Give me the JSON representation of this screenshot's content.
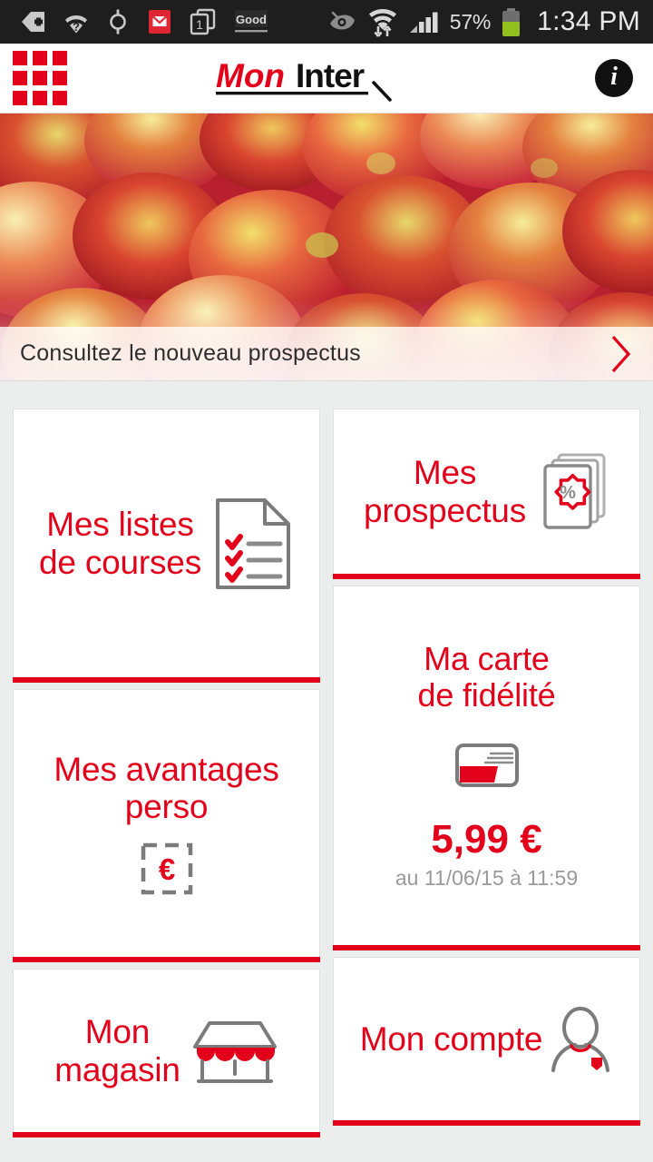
{
  "status_bar": {
    "time": "1:34 PM",
    "battery_percent": "57%",
    "battery_level": 57,
    "icons_left": [
      "plus-badge-icon",
      "wifi-question-icon",
      "gps-crosshair-icon",
      "mail-icon",
      "tasks-stack-icon",
      "good-app-icon"
    ],
    "icons_right": [
      "smart-stay-eye-icon",
      "wifi-data-icon",
      "cellular-signal-icon"
    ],
    "good_label": "Good",
    "task_count": "1"
  },
  "header": {
    "menu_icon": "grid-menu-icon",
    "logo": {
      "part_red": "Mon",
      "part_black": "Inter",
      "alt": "MonInter"
    },
    "info_icon": "info-icon",
    "info_glyph": "i"
  },
  "hero": {
    "image_alt": "red apples",
    "caption": "Consultez le nouveau prospectus",
    "chevron_icon": "chevron-right-icon"
  },
  "colors": {
    "brand_red": "#e3001b",
    "accent_gray": "#7b7b7b",
    "page_bg": "#eceded",
    "tile_bg": "#ffffff",
    "muted_text": "#9a9a9a"
  },
  "tiles": {
    "mes_listes": {
      "label": "Mes listes\nde courses",
      "line1": "Mes listes",
      "line2": "de courses",
      "icon": "document-checklist-icon"
    },
    "mes_avantages": {
      "label": "Mes avantages\nperso",
      "line1": "Mes avantages",
      "line2": "perso",
      "icon": "coupon-euro-icon"
    },
    "mon_magasin": {
      "label": "Mon\nmagasin",
      "line1": "Mon",
      "line2": "magasin",
      "icon": "storefront-icon"
    },
    "mes_prospectus": {
      "label": "Mes\nprospectus",
      "line1": "Mes",
      "line2": "prospectus",
      "icon": "leaflets-percent-icon"
    },
    "ma_carte": {
      "label": "Ma carte\nde fidélité",
      "line1": "Ma carte",
      "line2": "de fidélité",
      "icon": "loyalty-card-icon",
      "amount": "5,99 €",
      "amount_note": "au 11/06/15 à 11:59"
    },
    "mon_compte": {
      "label": "Mon compte",
      "line1": "Mon compte",
      "line2": "",
      "icon": "user-account-icon"
    }
  }
}
